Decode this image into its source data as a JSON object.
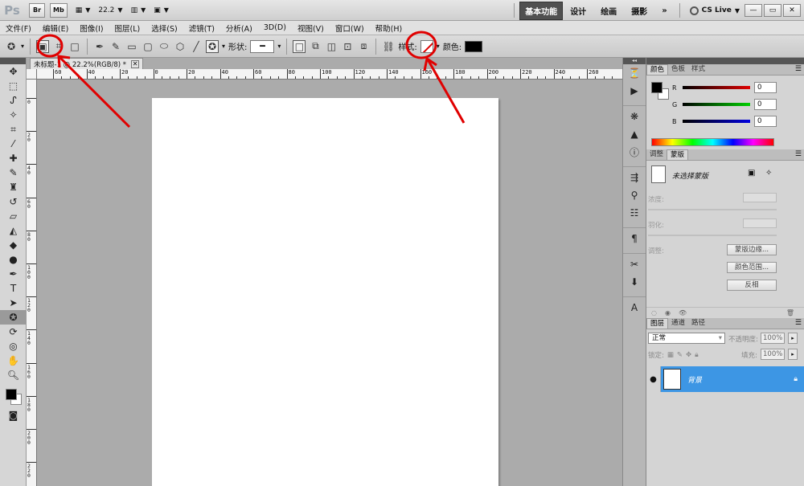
{
  "titlebar": {
    "app_logo": "Ps",
    "br_label": "Br",
    "mb_label": "Mb",
    "zoom_value": "22.2",
    "workspaces": {
      "active": "基本功能",
      "design": "设计",
      "paint": "绘画",
      "photo": "摄影",
      "more": "»"
    },
    "cs_live": "CS Live",
    "window_buttons": [
      "—",
      "▭",
      "✕"
    ]
  },
  "menu": [
    "文件(F)",
    "编辑(E)",
    "图像(I)",
    "图层(L)",
    "选择(S)",
    "滤镜(T)",
    "分析(A)",
    "3D(D)",
    "视图(V)",
    "窗口(W)",
    "帮助(H)"
  ],
  "options": {
    "shape_label": "形状:",
    "style_label": "样式:",
    "color_label": "颜色:",
    "color_value": "#000000"
  },
  "document": {
    "tab_title": "未标题-1 @ 22.2%(RGB/8) *",
    "h_ruler": [
      "60",
      "40",
      "20",
      "0",
      "20",
      "40",
      "60",
      "80",
      "100",
      "120",
      "140",
      "160",
      "180",
      "200",
      "220",
      "240",
      "260"
    ],
    "v_ruler": [
      "0",
      "2 0",
      "4 0",
      "6 0",
      "8 0",
      "1 0 0",
      "1 2 0",
      "1 4 0",
      "1 6 0",
      "1 8 0",
      "2 0 0",
      "2 2 0"
    ]
  },
  "panels": {
    "color": {
      "tabs": [
        "颜色",
        "色板",
        "样式"
      ],
      "r_label": "R",
      "g_label": "G",
      "b_label": "B",
      "r_value": "0",
      "g_value": "0",
      "b_value": "0"
    },
    "masks": {
      "tabs": [
        "调整",
        "蒙版"
      ],
      "title": "未选择蒙版",
      "density_label": "浓度:",
      "feather_label": "羽化:",
      "refine_label": "调整:",
      "btn_mask_edge": "蒙版边缘...",
      "btn_color_range": "颜色范围...",
      "btn_invert": "反相"
    },
    "layers": {
      "tabs": [
        "图层",
        "通道",
        "路径"
      ],
      "blend_mode": "正常",
      "opacity_label": "不透明度:",
      "opacity_value": "100%",
      "lock_label": "锁定:",
      "fill_label": "填充:",
      "fill_value": "100%",
      "layer_name": "背景"
    }
  },
  "colors": {
    "accent_blue": "#3d96e4",
    "annotation_red": "#e00000"
  }
}
